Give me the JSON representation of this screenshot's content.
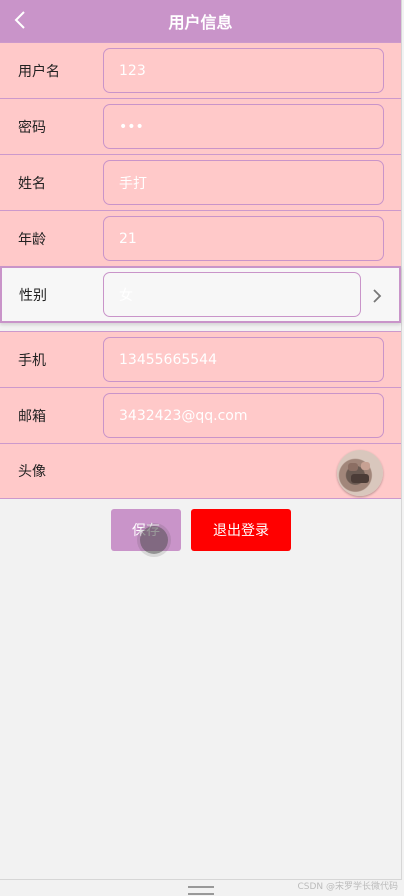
{
  "header": {
    "title": "用户信息"
  },
  "form": {
    "username": {
      "label": "用户名",
      "value": "123"
    },
    "password": {
      "label": "密码",
      "value": "•••"
    },
    "name": {
      "label": "姓名",
      "value": "手打"
    },
    "age": {
      "label": "年龄",
      "value": "21"
    },
    "gender": {
      "label": "性别",
      "value": "女"
    },
    "phone": {
      "label": "手机",
      "value": "13455665544"
    },
    "email": {
      "label": "邮箱",
      "value": "3432423@qq.com"
    },
    "avatar": {
      "label": "头像"
    }
  },
  "actions": {
    "save_label": "保存",
    "logout_label": "退出登录"
  },
  "watermark": "CSDN @宋罗学长微代码",
  "colors": {
    "accent": "#c994c9",
    "row_bg": "#ffc9c9",
    "danger": "#ff0000"
  }
}
